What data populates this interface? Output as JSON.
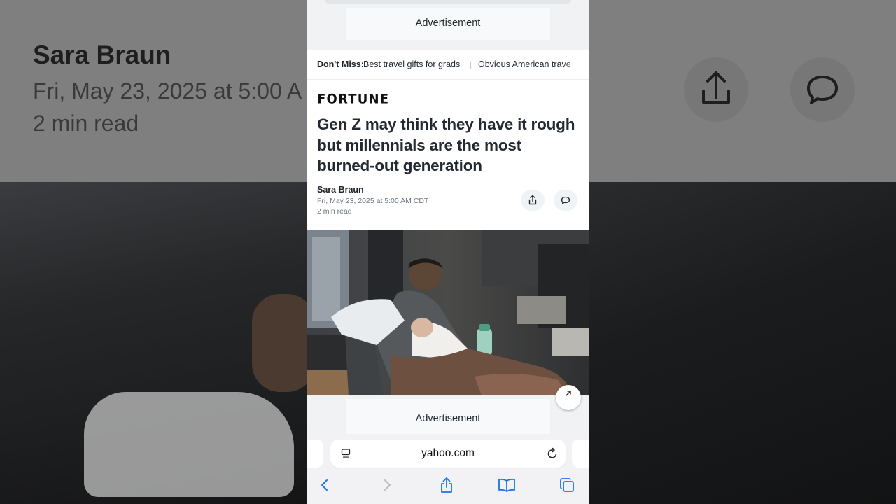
{
  "background": {
    "author": "Sara Braun",
    "date": "Fri, May 23, 2025 at 5:00 A",
    "read_time": "2 min read"
  },
  "ad": {
    "top_label": "Advertisement",
    "bottom_label": "Advertisement"
  },
  "dont_miss": {
    "label": "Don't Miss:",
    "links": [
      "Best travel gifts for grads",
      "Obvious American trave"
    ]
  },
  "article": {
    "publisher": "FORTUNE",
    "headline": "Gen Z may think they have it rough but millennials are the most burned-out generation",
    "author": "Sara Braun",
    "date": "Fri, May 23, 2025 at 5:00 AM CDT",
    "read_time": "2 min read"
  },
  "browser": {
    "url": "yahoo.com"
  },
  "icons": {
    "share": "share-icon",
    "comment": "comment-icon",
    "reader": "reader-mode-icon",
    "reload": "reload-icon",
    "back": "chevron-left-icon",
    "forward": "chevron-right-icon",
    "bookmarks": "book-icon",
    "tabs": "tabs-icon"
  },
  "colors": {
    "accent": "#1a73e8",
    "text": "#232a31",
    "muted": "#6e7780"
  }
}
